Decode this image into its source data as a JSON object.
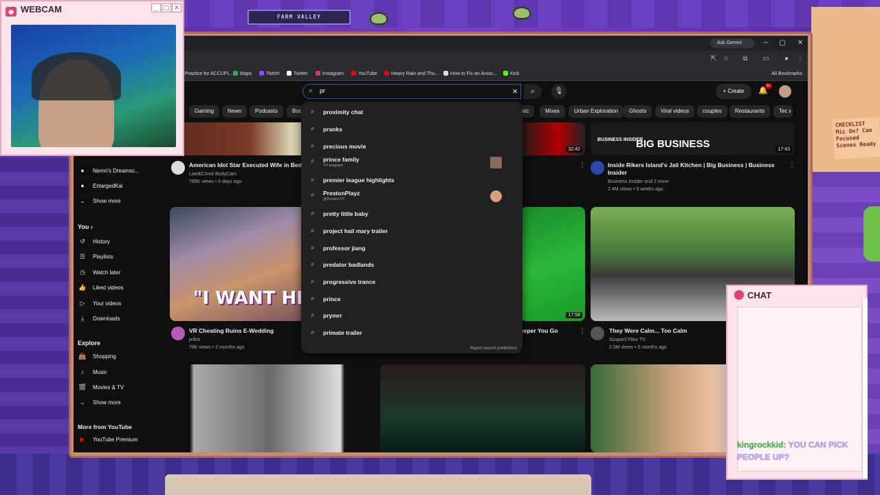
{
  "overlay": {
    "webcam_title": "WEBCAM",
    "chat_title": "CHAT",
    "chat_message_user": "kingrockkid:",
    "chat_message_text": "YOU CAN PICK PEOPLE UP?",
    "shelf_sign": "FARM VALLEY",
    "note_text": "CHECKLIST Mic On? Cam Focused Scenes Ready"
  },
  "browser": {
    "gemini_label": "Ask Gemini",
    "bookmarks": [
      {
        "label": "Practice for ACCUPL...",
        "color": "#4a8af4"
      },
      {
        "label": "Maps",
        "color": "#34a853"
      },
      {
        "label": "Twitch",
        "color": "#9146ff"
      },
      {
        "label": "Twitter",
        "color": "#ffffff"
      },
      {
        "label": "Instagram",
        "color": "#e1306c"
      },
      {
        "label": "YouTube",
        "color": "#ff0000"
      },
      {
        "label": "Heavy Rain and Thu...",
        "color": "#ff0000"
      },
      {
        "label": "How to Fix an Anxio...",
        "color": "#dddddd"
      },
      {
        "label": "Kick",
        "color": "#53fc18"
      }
    ],
    "all_bookmarks": "All Bookmarks"
  },
  "youtube": {
    "search_value": "pr",
    "create_label": "Create",
    "notif_badge": "9+",
    "chips": [
      "Gaming",
      "News",
      "Podcasts",
      "Bod",
      "usic",
      "Mixes",
      "Urban Exploration",
      "Ghosts",
      "Viral videos",
      "couples",
      "Restaurants",
      "Tec"
    ],
    "sidebar": {
      "subs": [
        "Nemo's Dreamsc...",
        "EnlargedKai"
      ],
      "show_more": "Show more",
      "you_label": "You",
      "you_items": [
        "History",
        "Playlists",
        "Watch later",
        "Liked videos",
        "Your videos",
        "Downloads"
      ],
      "explore_label": "Explore",
      "explore_items": [
        "Shopping",
        "Music",
        "Movies & TV"
      ],
      "show_more_2": "Show more",
      "more_label": "More from YouTube",
      "premium": "YouTube Premium"
    },
    "videos": [
      {
        "title": "American Idol Star Executed Wife in Bedr...",
        "channel": "Law&Crime BodyCam",
        "meta": "789K views • 5 days ago"
      },
      {
        "title": "Inside Rikers Island's Jail Kitchen | Big Business | Business Insider",
        "channel": "Business Insider and 2 more",
        "meta": "2.4M views • 3 weeks ago",
        "duration": "17:43",
        "thumb_text": "BIG BUSINESS",
        "thumb_sub": "BUSINESS INSIDER"
      },
      {
        "duration": "32:42"
      },
      {
        "title": "VR Cheating Ruins E-Wedding",
        "channel": "jelliot",
        "meta": "78K views • 2 months ago",
        "thumb_text": "\"I WANT HIM I"
      },
      {
        "title": "eeper You Go",
        "duration": "17:58"
      },
      {
        "title": "They Were Calm... Too Calm",
        "channel": "Suspect Files TV",
        "meta": "2.5M views • 5 months ago"
      }
    ],
    "suggestions": [
      {
        "text": "proximity chat"
      },
      {
        "text": "pranks"
      },
      {
        "text": "precious movie"
      },
      {
        "text": "prince family",
        "sub": "TV program",
        "thumb": "#8a6a5a"
      },
      {
        "text": "premier league highlights"
      },
      {
        "text": "PrestonPlayz",
        "sub": "@PrestonYT",
        "thumb": "#d9a07a"
      },
      {
        "text": "pretty little baby"
      },
      {
        "text": "project hail mary trailer"
      },
      {
        "text": "professor jiang"
      },
      {
        "text": "predator badlands"
      },
      {
        "text": "progressive trance"
      },
      {
        "text": "prince"
      },
      {
        "text": "prymrr"
      },
      {
        "text": "primate trailer"
      }
    ],
    "report": "Report search predictions"
  }
}
